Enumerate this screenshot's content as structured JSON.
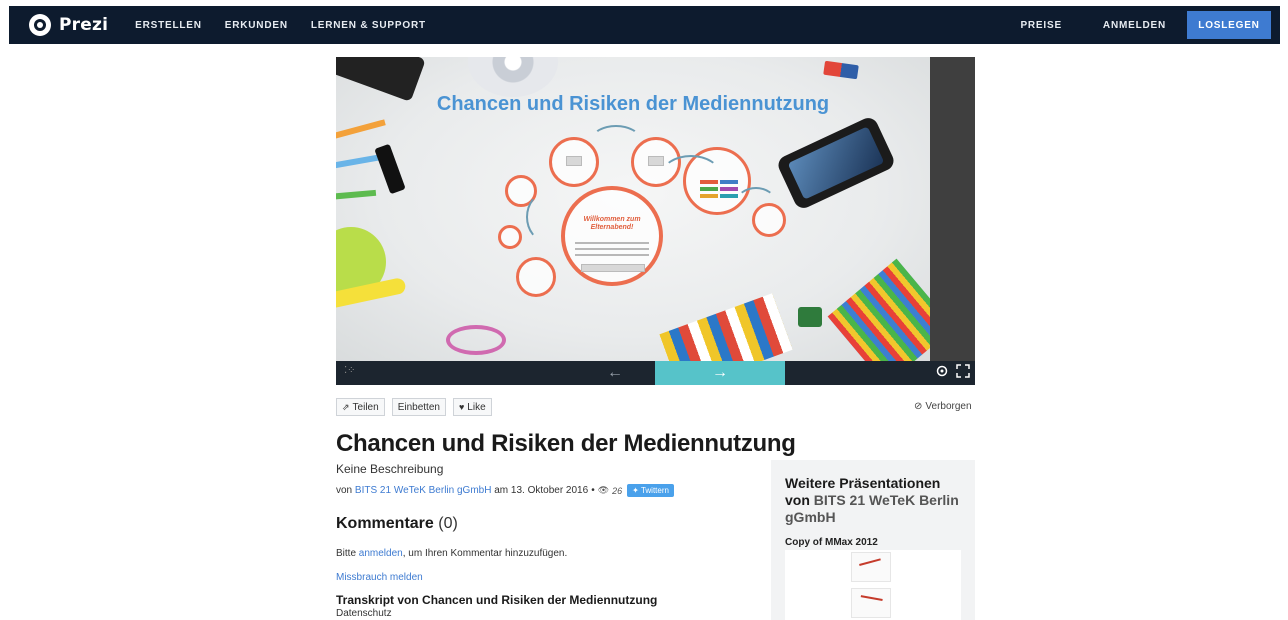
{
  "nav": {
    "logo_text": "Prezi",
    "links": [
      "ERSTELLEN",
      "ERKUNDEN",
      "LERNEN & SUPPORT"
    ],
    "preise": "PREISE",
    "anmelden": "ANMELDEN",
    "cta": "LOSLEGEN"
  },
  "viewer": {
    "slide_title": "Chancen und Risiken der Mediennutzung",
    "center_title_1": "Willkommen zum",
    "center_title_2": "Elternabend!"
  },
  "actions": {
    "share": "Teilen",
    "embed": "Einbetten",
    "like": "Like",
    "visibility": "Verborgen"
  },
  "presentation": {
    "title": "Chancen und Risiken der Mediennutzung",
    "description": "Keine Beschreibung",
    "by": "von",
    "author": "BITS 21 WeTeK Berlin gGmbH",
    "date": "am 13. Oktober 2016",
    "bullet": "•",
    "views": "26",
    "tweet": "Twittern"
  },
  "comments": {
    "heading": "Kommentare",
    "count": "(0)",
    "hint_before": "Bitte ",
    "hint_link": "anmelden",
    "hint_after": ", um Ihren Kommentar hinzuzufügen.",
    "report": "Missbrauch melden"
  },
  "transcript": {
    "heading": "Transkript von Chancen und Risiken der Mediennutzung",
    "text": "Datenschutz"
  },
  "sidebar": {
    "title_prefix": "Weitere Präsentationen von",
    "author": "BITS 21 WeTeK Berlin gGmbH",
    "item_label": "Copy of MMax 2012"
  },
  "colors": {
    "nav_bg": "#0d1b2e",
    "cta": "#3e7bd1",
    "next_button": "#56c3c9",
    "link": "#3e7bd1",
    "accent_ring": "#ec6e4f",
    "slide_title": "#4a93d3"
  }
}
